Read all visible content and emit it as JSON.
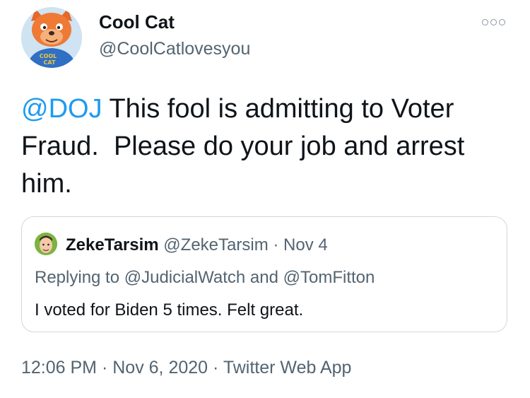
{
  "tweet": {
    "author": {
      "display_name": "Cool Cat",
      "handle": "@CoolCatlovesyou",
      "avatar_text": "COOL CAT"
    },
    "more_icon": "more-options-icon",
    "mention": "@DOJ",
    "text": " This fool is admitting to Voter Fraud.  Please do your job and arrest him.",
    "footer": {
      "time": "12:06 PM",
      "separator": "·",
      "date": "Nov 6, 2020",
      "source": "Twitter Web App"
    }
  },
  "quoted_tweet": {
    "display_name": "ZekeTarsim",
    "handle": "@ZekeTarsim",
    "separator": "·",
    "date": "Nov 4",
    "replying_to": "Replying to @JudicialWatch and @TomFitton",
    "text": "I voted for Biden 5 times. Felt great."
  }
}
